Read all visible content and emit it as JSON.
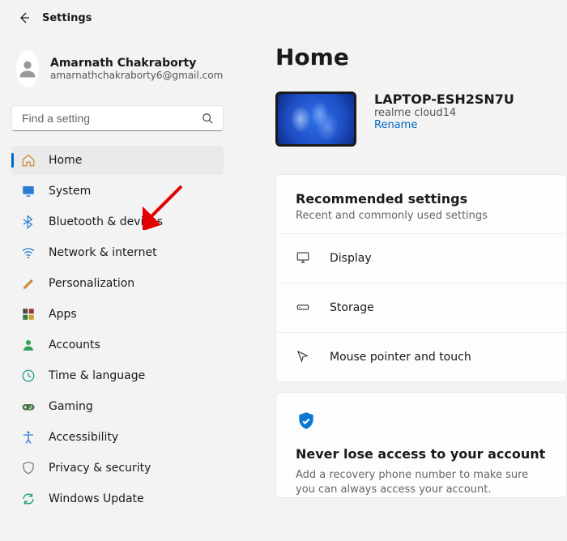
{
  "header": {
    "title": "Settings"
  },
  "user": {
    "name": "Amarnath Chakraborty",
    "email": "amarnathchakraborty6@gmail.com"
  },
  "search": {
    "placeholder": "Find a setting"
  },
  "nav": {
    "items": [
      {
        "label": "Home",
        "icon": "home",
        "selected": true
      },
      {
        "label": "System",
        "icon": "system",
        "selected": false
      },
      {
        "label": "Bluetooth & devices",
        "icon": "bluetooth",
        "selected": false
      },
      {
        "label": "Network & internet",
        "icon": "network",
        "selected": false
      },
      {
        "label": "Personalization",
        "icon": "personalization",
        "selected": false
      },
      {
        "label": "Apps",
        "icon": "apps",
        "selected": false
      },
      {
        "label": "Accounts",
        "icon": "accounts",
        "selected": false
      },
      {
        "label": "Time & language",
        "icon": "time",
        "selected": false
      },
      {
        "label": "Gaming",
        "icon": "gaming",
        "selected": false
      },
      {
        "label": "Accessibility",
        "icon": "accessibility",
        "selected": false
      },
      {
        "label": "Privacy & security",
        "icon": "privacy",
        "selected": false
      },
      {
        "label": "Windows Update",
        "icon": "update",
        "selected": false
      }
    ]
  },
  "main": {
    "title": "Home",
    "device": {
      "name": "LAPTOP-ESH2SN7U",
      "sub": "realme cloud14",
      "rename": "Rename"
    },
    "recommended": {
      "title": "Recommended settings",
      "sub": "Recent and commonly used settings",
      "items": [
        {
          "label": "Display",
          "icon": "display"
        },
        {
          "label": "Storage",
          "icon": "storage"
        },
        {
          "label": "Mouse pointer and touch",
          "icon": "pointer"
        }
      ]
    },
    "account": {
      "title": "Never lose access to your account",
      "sub": "Add a recovery phone number to make sure you can always access your account."
    }
  },
  "annotation": {
    "arrow_target": "bluetooth-devices"
  },
  "colors": {
    "accent": "#0067c0",
    "arrow": "#e30000"
  }
}
